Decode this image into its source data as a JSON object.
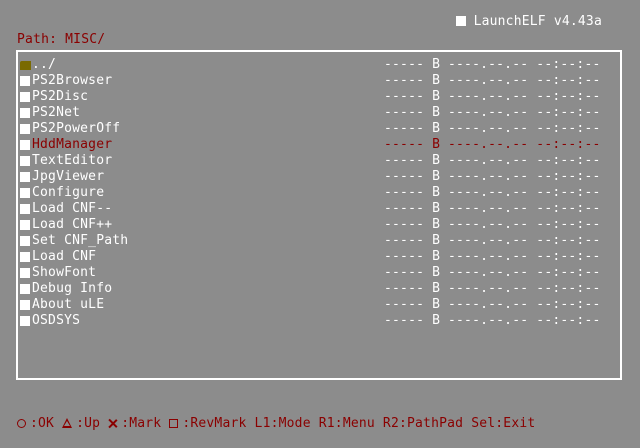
{
  "header": {
    "app_title": "LaunchELF v4.43a",
    "path": "Path: MISC/"
  },
  "colors": {
    "background": "#8c8c8c",
    "text": "#ffffff",
    "highlight": "#8a0000",
    "folder": "#7a6a00"
  },
  "files": [
    {
      "name": "../",
      "icon": "folder-icon",
      "size": "----- B",
      "date": "----.--.-- --:--:--"
    },
    {
      "name": "PS2Browser",
      "icon": "file-icon",
      "size": "----- B",
      "date": "----.--.-- --:--:--"
    },
    {
      "name": "PS2Disc",
      "icon": "file-icon",
      "size": "----- B",
      "date": "----.--.-- --:--:--"
    },
    {
      "name": "PS2Net",
      "icon": "file-icon",
      "size": "----- B",
      "date": "----.--.-- --:--:--"
    },
    {
      "name": "PS2PowerOff",
      "icon": "file-icon",
      "size": "----- B",
      "date": "----.--.-- --:--:--"
    },
    {
      "name": "HddManager",
      "icon": "file-icon",
      "size": "----- B",
      "date": "----.--.-- --:--:--",
      "selected": true
    },
    {
      "name": "TextEditor",
      "icon": "file-icon",
      "size": "----- B",
      "date": "----.--.-- --:--:--"
    },
    {
      "name": "JpgViewer",
      "icon": "file-icon",
      "size": "----- B",
      "date": "----.--.-- --:--:--"
    },
    {
      "name": "Configure",
      "icon": "file-icon",
      "size": "----- B",
      "date": "----.--.-- --:--:--"
    },
    {
      "name": "Load CNF--",
      "icon": "file-icon",
      "size": "----- B",
      "date": "----.--.-- --:--:--"
    },
    {
      "name": "Load CNF++",
      "icon": "file-icon",
      "size": "----- B",
      "date": "----.--.-- --:--:--"
    },
    {
      "name": "Set CNF_Path",
      "icon": "file-icon",
      "size": "----- B",
      "date": "----.--.-- --:--:--"
    },
    {
      "name": "Load CNF",
      "icon": "file-icon",
      "size": "----- B",
      "date": "----.--.-- --:--:--"
    },
    {
      "name": "ShowFont",
      "icon": "file-icon",
      "size": "----- B",
      "date": "----.--.-- --:--:--"
    },
    {
      "name": "Debug Info",
      "icon": "file-icon",
      "size": "----- B",
      "date": "----.--.-- --:--:--"
    },
    {
      "name": "About uLE",
      "icon": "file-icon",
      "size": "----- B",
      "date": "----.--.-- --:--:--"
    },
    {
      "name": "OSDSYS",
      "icon": "file-icon",
      "size": "----- B",
      "date": "----.--.-- --:--:--"
    }
  ],
  "footer": {
    "hints": [
      {
        "glyph": "circle-icon",
        "label": ":OK"
      },
      {
        "glyph": "triangle-icon",
        "label": ":Up"
      },
      {
        "glyph": "cross-icon",
        "label": ":Mark"
      },
      {
        "glyph": "square-icon",
        "label": ":RevMark"
      },
      {
        "glyph": "",
        "label": "L1:Mode"
      },
      {
        "glyph": "",
        "label": "R1:Menu"
      },
      {
        "glyph": "",
        "label": "R2:PathPad"
      },
      {
        "glyph": "",
        "label": "Sel:Exit"
      }
    ]
  }
}
